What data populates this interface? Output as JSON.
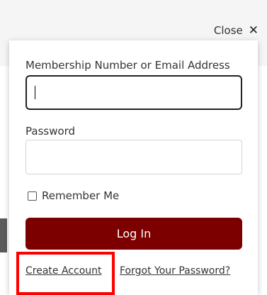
{
  "dialog": {
    "close_label": "Close",
    "close_icon": "close-icon",
    "email_label": "Membership Number or Email Address",
    "email_value": "",
    "password_label": "Password",
    "password_value": "",
    "remember_label": "Remember Me",
    "remember_checked": false,
    "login_label": "Log In",
    "create_account_label": "Create Account",
    "forgot_password_label": "Forgot Your Password?"
  },
  "colors": {
    "primary_button": "#7d0000",
    "highlight": "#ff0000"
  }
}
